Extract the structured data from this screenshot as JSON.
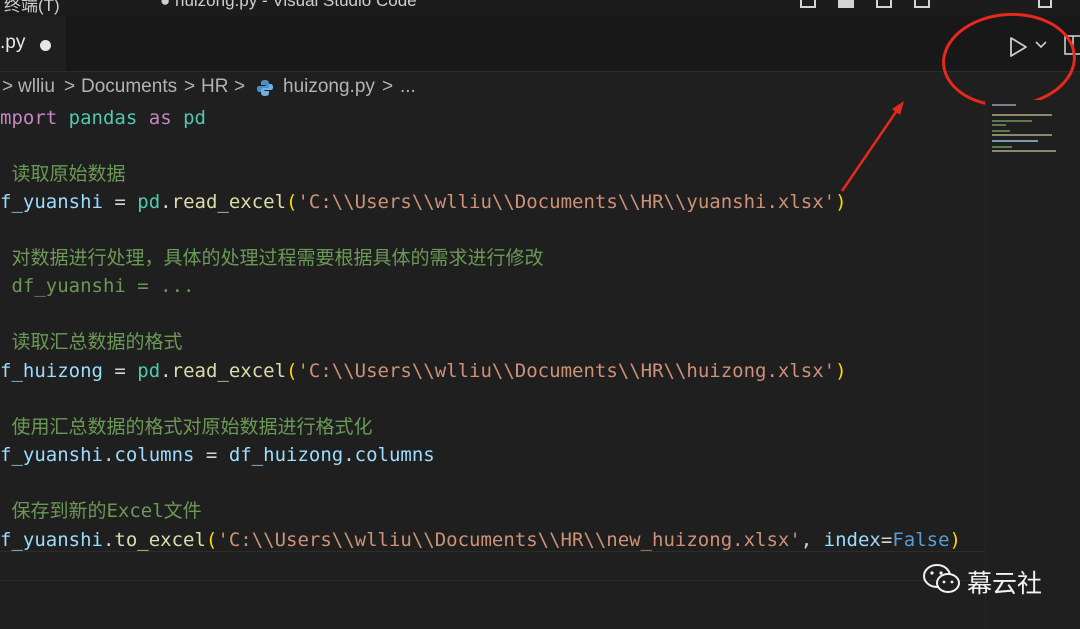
{
  "titlebar": {
    "left_title": "终端(T)",
    "file_title": "● huizong.py - Visual Studio Code"
  },
  "tab": {
    "label": ".py",
    "dirty_indicator": "unsaved-dot"
  },
  "toolbar": {
    "run_icon": "play-icon",
    "run_dropdown_icon": "chevron-down-icon",
    "split_icon": "split-editor-icon"
  },
  "breadcrumb": {
    "items": [
      "wlliu",
      "Documents",
      "HR",
      "huizong.py",
      "..."
    ],
    "separator": ">"
  },
  "code": {
    "l1": {
      "a": "mport",
      "b": " ",
      "c": "pandas",
      "d": " ",
      "e": "as",
      "f": " ",
      "g": "pd"
    },
    "l2": " 读取原始数据",
    "l3": {
      "var": "f_yuanshi",
      "eq": " = ",
      "mod": "pd",
      "dot": ".",
      "fn": "read_excel",
      "open": "(",
      "str": "'C:\\\\Users\\\\wlliu\\\\Documents\\\\HR\\\\yuanshi.xlsx'",
      "close": ")"
    },
    "l4": " 对数据进行处理，具体的处理过程需要根据具体的需求进行修改",
    "l5": " df_yuanshi = ...",
    "l6": " 读取汇总数据的格式",
    "l7": {
      "var": "f_huizong",
      "eq": " = ",
      "mod": "pd",
      "dot": ".",
      "fn": "read_excel",
      "open": "(",
      "str": "'C:\\\\Users\\\\wlliu\\\\Documents\\\\HR\\\\huizong.xlsx'",
      "close": ")"
    },
    "l8": " 使用汇总数据的格式对原始数据进行格式化",
    "l9": {
      "var": "f_yuanshi",
      "dot1": ".",
      "attr": "columns",
      "eq": " = ",
      "var2": "df_huizong",
      "dot2": ".",
      "attr2": "columns"
    },
    "l10": " 保存到新的Excel文件",
    "l11": {
      "var": "f_yuanshi",
      "dot": ".",
      "fn": "to_excel",
      "open": "(",
      "str": "'C:\\\\Users\\\\wlliu\\\\Documents\\\\HR\\\\new_huizong.xlsx'",
      "comma": ", ",
      "param": "index",
      "eq": "=",
      "const": "False",
      "close": ")"
    }
  },
  "watermark": {
    "logo": "wechat-icon",
    "text": "幕云社"
  },
  "colors": {
    "annotation": "#e8281e",
    "comment": "#6a9955",
    "string": "#ce9178",
    "function": "#dcdcaa",
    "variable": "#9cdcfe"
  }
}
